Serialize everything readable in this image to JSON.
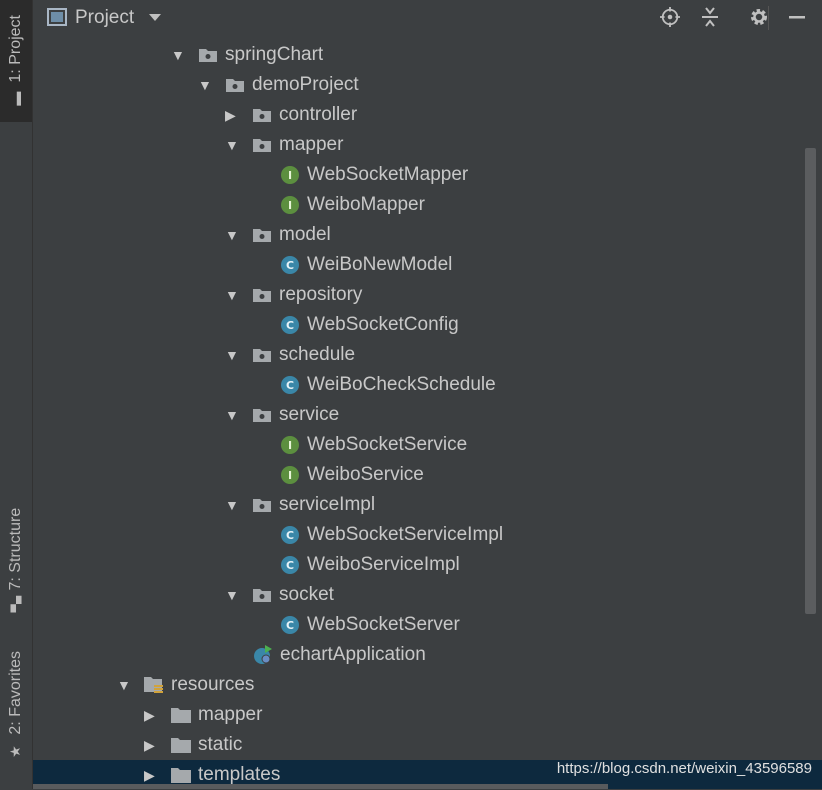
{
  "sidebar": {
    "project_tab": "1: Project",
    "structure_tab": "7: Structure",
    "favorites_tab": "2: Favorites"
  },
  "header": {
    "title": "Project",
    "icons": [
      "project-view-icon",
      "dropdown-icon",
      "locate-icon",
      "collapse-all-icon",
      "gear-icon",
      "minimize-icon"
    ]
  },
  "tree": {
    "springChart": "springChart",
    "demoProject": "demoProject",
    "controller": "controller",
    "mapper": "mapper",
    "WebSocketMapper": "WebSocketMapper",
    "WeiboMapper": "WeiboMapper",
    "model": "model",
    "WeiBoNewModel": "WeiBoNewModel",
    "repository": "repository",
    "WebSocketConfig": "WebSocketConfig",
    "schedule": "schedule",
    "WeiBoCheckSchedule": "WeiBoCheckSchedule",
    "service": "service",
    "WebSocketService": "WebSocketService",
    "WeiboService": "WeiboService",
    "serviceImpl": "serviceImpl",
    "WebSocketServiceImpl": "WebSocketServiceImpl",
    "WeiboServiceImpl": "WeiboServiceImpl",
    "socket": "socket",
    "WebSocketServer": "WebSocketServer",
    "echartApplication": "echartApplication",
    "resources": "resources",
    "res_mapper": "mapper",
    "static": "static",
    "templates": "templates"
  },
  "badges": {
    "interface": "I",
    "class": "C"
  },
  "watermark": "https://blog.csdn.net/weixin_43596589",
  "colors": {
    "background": "#3c3f41",
    "selection": "#0d293e",
    "interface_badge": "#5c8f3f",
    "class_badge": "#3a87a8"
  }
}
